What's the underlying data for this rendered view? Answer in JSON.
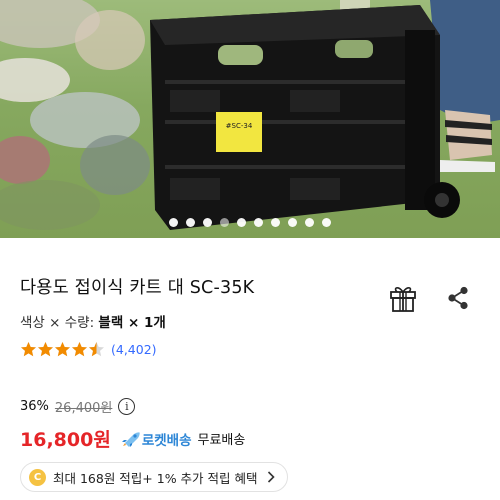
{
  "hero": {
    "image_alt": "black folding cart",
    "cart_tag_text": "#SC-34",
    "carousel_count": 10,
    "carousel_active_index": 3
  },
  "product": {
    "title": "다용도 접이식 카트 대 SC-35K",
    "option_prefix": "색상 × 수량:",
    "option_value": "블랙 × 1개",
    "rating_stars": 4.5,
    "rating_count": "(4,402)"
  },
  "price": {
    "discount_rate": "36%",
    "original_price": "26,400원",
    "info_icon_text": "i",
    "sale_price": "16,800원",
    "delivery_badge": "로켓배송",
    "free_shipping": "무료배송"
  },
  "reward": {
    "coin_symbol": "C",
    "text": "최대 168원 적립+ 1% 추가 적립 혜택"
  },
  "colors": {
    "sale_red": "#e52528",
    "rocket_blue": "#2d86d6",
    "rating_blue": "#346aff",
    "star_orange": "#f28b00",
    "coin_yellow": "#f5c242"
  },
  "icons": [
    "gift-icon",
    "share-icon",
    "star-icon",
    "info-icon",
    "rocket-icon",
    "coin-icon",
    "chevron-right-icon"
  ]
}
